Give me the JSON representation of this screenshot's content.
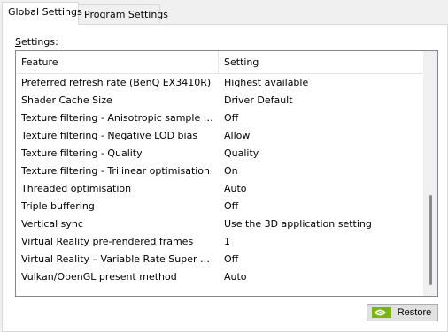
{
  "tabs": [
    {
      "label": "Global Settings",
      "active": true
    },
    {
      "label": "Program Settings",
      "active": false
    }
  ],
  "settings_label": {
    "accelerator": "S",
    "rest": "ettings:"
  },
  "table": {
    "columns": [
      "Feature",
      "Setting"
    ],
    "rows": [
      {
        "feature": "Preferred refresh rate (BenQ EX3410R)",
        "setting": "Highest available"
      },
      {
        "feature": "Shader Cache Size",
        "setting": "Driver Default"
      },
      {
        "feature": "Texture filtering - Anisotropic sample opti...",
        "setting": "Off"
      },
      {
        "feature": "Texture filtering - Negative LOD bias",
        "setting": "Allow"
      },
      {
        "feature": "Texture filtering - Quality",
        "setting": "Quality"
      },
      {
        "feature": "Texture filtering - Trilinear optimisation",
        "setting": "On"
      },
      {
        "feature": "Threaded optimisation",
        "setting": "Auto"
      },
      {
        "feature": "Triple buffering",
        "setting": "Off"
      },
      {
        "feature": "Vertical sync",
        "setting": "Use the 3D application setting"
      },
      {
        "feature": "Virtual Reality pre-rendered frames",
        "setting": "1"
      },
      {
        "feature": "Virtual Reality – Variable Rate Super Samp...",
        "setting": "Off"
      },
      {
        "feature": "Vulkan/OpenGL present method",
        "setting": "Auto"
      }
    ]
  },
  "restore_button": {
    "label": "Restore",
    "icon": "nvidia-logo-icon"
  },
  "colors": {
    "nvidia_green": "#76b900"
  }
}
